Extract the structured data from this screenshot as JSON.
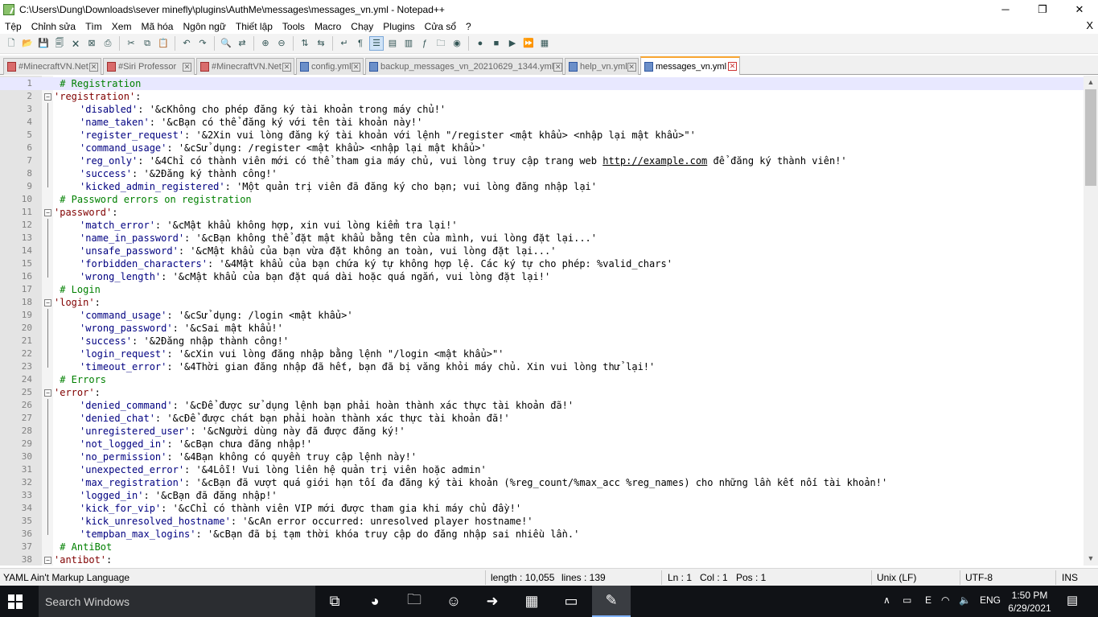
{
  "window": {
    "title": "C:\\Users\\Dung\\Downloads\\sever minefly\\plugins\\AuthMe\\messages\\messages_vn.yml - Notepad++",
    "minimize": "─",
    "maximize": "❐",
    "close": "✕"
  },
  "menu": {
    "items": [
      "Tệp",
      "Chỉnh sửa",
      "Tìm",
      "Xem",
      "Mã hóa",
      "Ngôn ngữ",
      "Thiết lập",
      "Tools",
      "Macro",
      "Chạy",
      "Plugins",
      "Cửa sổ",
      "?"
    ],
    "close": "X"
  },
  "toolbar": {
    "icons": [
      "new-file-icon",
      "open-file-icon",
      "save-icon",
      "save-all-icon",
      "close-icon",
      "close-all-icon",
      "print-icon",
      "sep",
      "cut-icon",
      "copy-icon",
      "paste-icon",
      "sep",
      "undo-icon",
      "redo-icon",
      "sep",
      "find-icon",
      "replace-icon",
      "sep",
      "zoom-in-icon",
      "zoom-out-icon",
      "sep",
      "sync-vertical-icon",
      "sync-horizontal-icon",
      "sep",
      "word-wrap-icon",
      "show-all-chars-icon",
      "indent-guide-icon",
      "udl-icon",
      "doc-map-icon",
      "function-list-icon",
      "folder-workspace-icon",
      "monitor-icon",
      "sep",
      "record-macro-icon",
      "stop-record-icon",
      "play-macro-icon",
      "run-macro-multiple-icon",
      "save-macro-icon"
    ],
    "glyphs": {
      "new-file-icon": "🗋",
      "open-file-icon": "📂",
      "save-icon": "💾",
      "save-all-icon": "🗐",
      "close-icon": "🗙",
      "close-all-icon": "⊠",
      "print-icon": "⎙",
      "cut-icon": "✂",
      "copy-icon": "⧉",
      "paste-icon": "📋",
      "undo-icon": "↶",
      "redo-icon": "↷",
      "find-icon": "🔍",
      "replace-icon": "⇄",
      "zoom-in-icon": "⊕",
      "zoom-out-icon": "⊖",
      "sync-vertical-icon": "⇅",
      "sync-horizontal-icon": "⇆",
      "word-wrap-icon": "↵",
      "show-all-chars-icon": "¶",
      "indent-guide-icon": "☰",
      "udl-icon": "▤",
      "doc-map-icon": "▥",
      "function-list-icon": "ƒ",
      "folder-workspace-icon": "🗀",
      "monitor-icon": "◉",
      "record-macro-icon": "●",
      "stop-record-icon": "■",
      "play-macro-icon": "▶",
      "run-macro-multiple-icon": "⏩",
      "save-macro-icon": "▦"
    },
    "active": "indent-guide-icon"
  },
  "tabs": [
    {
      "label": "#MinecraftVN.Net",
      "icon": "red",
      "active": false
    },
    {
      "label": "#Siri Professor",
      "icon": "red",
      "active": false
    },
    {
      "label": "#MinecraftVN.Net",
      "icon": "red",
      "active": false
    },
    {
      "label": "config.yml",
      "icon": "blue",
      "active": false
    },
    {
      "label": "backup_messages_vn_20210629_1344.yml",
      "icon": "blue",
      "active": false
    },
    {
      "label": "help_vn.yml",
      "icon": "blue",
      "active": false
    },
    {
      "label": "messages_vn.yml",
      "icon": "blue",
      "active": true
    }
  ],
  "tab_close": "✕",
  "editor": {
    "lines": [
      {
        "n": "1",
        "level": "comment",
        "text": "# Registration",
        "fold": "none",
        "cur": true
      },
      {
        "n": "2",
        "level": "section",
        "key": "'registration'",
        "rest": ":",
        "fold": "open"
      },
      {
        "n": "3",
        "level": "item",
        "key": "'disabled'",
        "rest": ": '&cKhông cho phép đăng ký tài khoản trong máy chủ!'"
      },
      {
        "n": "4",
        "level": "item",
        "key": "'name_taken'",
        "rest": ": '&cBạn có thể đăng ký với tên tài khoản này!'"
      },
      {
        "n": "5",
        "level": "item",
        "key": "'register_request'",
        "rest": ": '&2Xin vui lòng đăng ký tài khoản với lệnh \"/register <mật khẩu> <nhập lại mật khẩu>\"'"
      },
      {
        "n": "6",
        "level": "item",
        "key": "'command_usage'",
        "rest": ": '&cSử dụng: /register <mật khẩu> <nhập lại mật khẩu>'"
      },
      {
        "n": "7",
        "level": "item",
        "key": "'reg_only'",
        "rest": ": '&4Chỉ có thành viên mới có thể tham gia máy chủ, vui lòng truy cập trang web ",
        "link": "http://example.com",
        "after": " để đăng ký thành viên!'"
      },
      {
        "n": "8",
        "level": "item",
        "key": "'success'",
        "rest": ": '&2Đăng ký thành công!'"
      },
      {
        "n": "9",
        "level": "item",
        "key": "'kicked_admin_registered'",
        "rest": ": 'Một quản trị viên đã đăng ký cho bạn; vui lòng đăng nhập lại'",
        "last": true
      },
      {
        "n": "10",
        "level": "comment",
        "text": "# Password errors on registration"
      },
      {
        "n": "11",
        "level": "section",
        "key": "'password'",
        "rest": ":",
        "fold": "open"
      },
      {
        "n": "12",
        "level": "item",
        "key": "'match_error'",
        "rest": ": '&cMật khẩu không hợp, xin vui lòng kiểm tra lại!'"
      },
      {
        "n": "13",
        "level": "item",
        "key": "'name_in_password'",
        "rest": ": '&cBạn không thể đặt mật khẩu bằng tên của mình, vui lòng đặt lại...'"
      },
      {
        "n": "14",
        "level": "item",
        "key": "'unsafe_password'",
        "rest": ": '&cMật khẩu của bạn vừa đặt không an toàn, vui lòng đặt lại...'"
      },
      {
        "n": "15",
        "level": "item",
        "key": "'forbidden_characters'",
        "rest": ": '&4Mật khẩu của bạn chứa ký tự không hợp lệ. Các ký tự cho phép: %valid_chars'"
      },
      {
        "n": "16",
        "level": "item",
        "key": "'wrong_length'",
        "rest": ": '&cMật khẩu của bạn đặt quá dài hoặc quá ngắn, vui lòng đặt lại!'",
        "last": true
      },
      {
        "n": "17",
        "level": "comment",
        "text": "# Login"
      },
      {
        "n": "18",
        "level": "section",
        "key": "'login'",
        "rest": ":",
        "fold": "open"
      },
      {
        "n": "19",
        "level": "item",
        "key": "'command_usage'",
        "rest": ": '&cSử dụng: /login <mật khẩu>'"
      },
      {
        "n": "20",
        "level": "item",
        "key": "'wrong_password'",
        "rest": ": '&cSai mật khẩu!'"
      },
      {
        "n": "21",
        "level": "item",
        "key": "'success'",
        "rest": ": '&2Đăng nhập thành công!'"
      },
      {
        "n": "22",
        "level": "item",
        "key": "'login_request'",
        "rest": ": '&cXin vui lòng đăng nhập bằng lệnh \"/login <mật khẩu>\"'"
      },
      {
        "n": "23",
        "level": "item",
        "key": "'timeout_error'",
        "rest": ": '&4Thời gian đăng nhập đã hết, bạn đã bị văng khỏi máy chủ. Xin vui lòng thử lại!'",
        "last": true
      },
      {
        "n": "24",
        "level": "comment",
        "text": "# Errors"
      },
      {
        "n": "25",
        "level": "section",
        "key": "'error'",
        "rest": ":",
        "fold": "open"
      },
      {
        "n": "26",
        "level": "item",
        "key": "'denied_command'",
        "rest": ": '&cĐể được sử dụng lệnh bạn phải hoàn thành xác thực tài khoản đã!'"
      },
      {
        "n": "27",
        "level": "item",
        "key": "'denied_chat'",
        "rest": ": '&cĐể được chát bạn phải hoàn thành xác thực tài khoản đã!'"
      },
      {
        "n": "28",
        "level": "item",
        "key": "'unregistered_user'",
        "rest": ": '&cNgười dùng này đã được đăng ký!'"
      },
      {
        "n": "29",
        "level": "item",
        "key": "'not_logged_in'",
        "rest": ": '&cBạn chưa đăng nhập!'"
      },
      {
        "n": "30",
        "level": "item",
        "key": "'no_permission'",
        "rest": ": '&4Bạn không có quyền truy cập lệnh này!'"
      },
      {
        "n": "31",
        "level": "item",
        "key": "'unexpected_error'",
        "rest": ": '&4Lỗi! Vui lòng liên hệ quản trị viên hoặc admin'"
      },
      {
        "n": "32",
        "level": "item",
        "key": "'max_registration'",
        "rest": ": '&cBạn đã vượt quá giới hạn tối đa đăng ký tài khoản (%reg_count/%max_acc %reg_names) cho những lần kết nối tài khoản!'"
      },
      {
        "n": "33",
        "level": "item",
        "key": "'logged_in'",
        "rest": ": '&cBạn đã đăng nhập!'"
      },
      {
        "n": "34",
        "level": "item",
        "key": "'kick_for_vip'",
        "rest": ": '&cChỉ có thành viên VIP mới được tham gia khi máy chủ đầy!'"
      },
      {
        "n": "35",
        "level": "item",
        "key": "'kick_unresolved_hostname'",
        "rest": ": '&cAn error occurred: unresolved player hostname!'"
      },
      {
        "n": "36",
        "level": "item",
        "key": "'tempban_max_logins'",
        "rest": ": '&cBạn đã bị tạm thời khóa truy cập do đăng nhập sai nhiều lần.'",
        "last": true
      },
      {
        "n": "37",
        "level": "comment",
        "text": "# AntiBot"
      },
      {
        "n": "38",
        "level": "section",
        "key": "'antibot'",
        "rest": ":",
        "fold": "open"
      }
    ]
  },
  "scrollbar": {
    "up": "▲",
    "down": "▼"
  },
  "status": {
    "lang": "YAML Ain't Markup Language",
    "length": "length : 10,055",
    "lines": "lines : 139",
    "ln": "Ln : 1",
    "col": "Col : 1",
    "pos": "Pos : 1",
    "eol": "Unix (LF)",
    "enc": "UTF-8",
    "mode": "INS"
  },
  "taskbar": {
    "search_placeholder": "Search Windows",
    "tray_ime": "E",
    "lang": "ENG",
    "time": "1:50 PM",
    "date": "6/29/2021",
    "apps": [
      "task-view-icon",
      "chrome-canary-icon",
      "file-explorer-icon",
      "discord-icon",
      "arrow-app-icon",
      "minecraft-icon",
      "terminal-icon",
      "notepadpp-icon"
    ],
    "app_glyphs": {
      "task-view-icon": "⧉",
      "chrome-canary-icon": "◕",
      "file-explorer-icon": "🗀",
      "discord-icon": "☺",
      "arrow-app-icon": "➜",
      "minecraft-icon": "▦",
      "terminal-icon": "▭",
      "notepadpp-icon": "✎"
    },
    "active_app": "notepadpp-icon",
    "tray_glyphs": {
      "chevron": "∧",
      "battery": "▭",
      "wifi": "◠",
      "volume": "🔈",
      "notification": "▤"
    }
  }
}
